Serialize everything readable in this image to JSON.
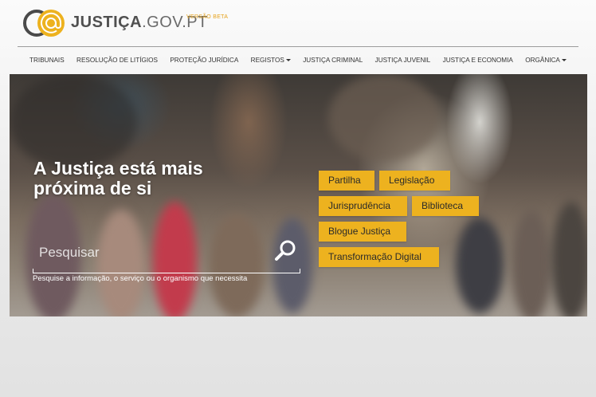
{
  "header": {
    "brand_bold": "JUSTIÇA",
    "brand_light": ".GOV.PT",
    "beta": "VERSÃO BETA"
  },
  "nav": {
    "items": [
      {
        "label": "TRIBUNAIS"
      },
      {
        "label": "RESOLUÇÃO DE LITÍGIOS"
      },
      {
        "label": "PROTEÇÃO JURÍDICA"
      },
      {
        "label": "REGISTOS",
        "dropdown": true
      },
      {
        "label": "JUSTIÇA CRIMINAL"
      },
      {
        "label": "JUSTIÇA JUVENIL"
      },
      {
        "label": "JUSTIÇA E ECONOMIA"
      },
      {
        "label": "ORGÂNICA",
        "dropdown": true
      }
    ]
  },
  "hero": {
    "title_line1": "A Justiça está mais",
    "title_line2": "próxima de si",
    "search": {
      "placeholder": "Pesquisar",
      "help": "Pesquise a informação, o serviço ou o organismo que necessita"
    },
    "tags": [
      "Partilha",
      "Legislação",
      "Jurisprudência",
      "Biblioteca",
      "Blogue Justiça",
      "Transformação Digital"
    ]
  },
  "colors": {
    "accent": "#edb21f",
    "beta": "#e6a21b",
    "logo_dark": "#4a4a4a"
  },
  "icons": {
    "logo": "at-sign-logo-icon",
    "search": "search-icon",
    "caret": "caret-down-icon"
  }
}
